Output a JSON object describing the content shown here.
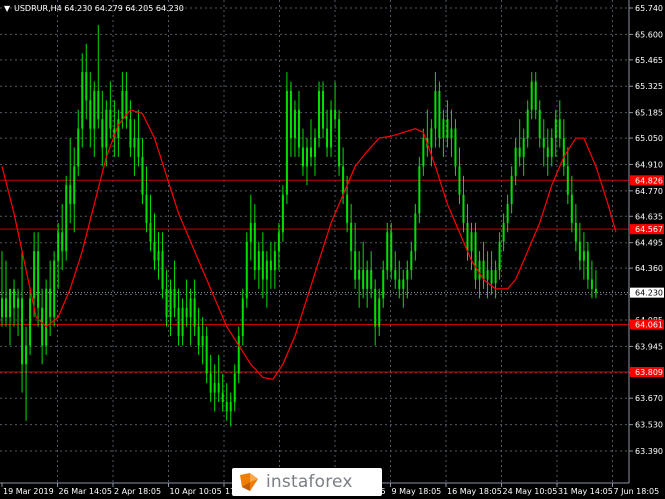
{
  "header": {
    "arrow": "▼",
    "text": "USDRUR,H4  64.230 64.279 64.205 64.230"
  },
  "colors": {
    "background": "#000000",
    "grid": "#4f5a66",
    "candle": "#00e000",
    "ma": "#ff0000",
    "level": "#c80000",
    "label_bg": "#ff0000",
    "current_bg": "#000000"
  },
  "watermark": {
    "text": "instaforex",
    "logo": "instaforex-logo-icon"
  },
  "chart_data": {
    "type": "candlestick",
    "symbol": "USDRUR",
    "timeframe": "H4",
    "ohlc_header": [
      64.23,
      64.279,
      64.205,
      64.23
    ],
    "y_range": [
      63.39,
      65.74
    ],
    "y_ticks": [
      "65.740",
      "65.600",
      "65.465",
      "65.325",
      "65.185",
      "65.050",
      "64.910",
      "64.770",
      "64.635",
      "64.495",
      "64.360",
      "64.220",
      "64.085",
      "63.945",
      "63.805",
      "63.670",
      "63.530",
      "63.390"
    ],
    "x_ticks": [
      "19 Mar 2019",
      "26 Mar 14:05",
      "2 Apr 18:05",
      "10 Apr 10:05",
      "17 Apr 18:05",
      "24 Apr 18:05",
      "2 May 10:05",
      "9 May 18:05",
      "16 May 18:05",
      "24 May 10:05",
      "31 May 14:05",
      "7 Jun 18:05"
    ],
    "levels": [
      {
        "value": 64.826,
        "label": "64.826"
      },
      {
        "value": 64.567,
        "label": "64.567"
      },
      {
        "value": 64.061,
        "label": "64.061"
      },
      {
        "value": 63.809,
        "label": "63.809"
      }
    ],
    "current_price": {
      "value": 64.23,
      "label": "64.230"
    },
    "grid": true,
    "moving_average": [
      [
        0,
        64.9
      ],
      [
        6,
        64.65
      ],
      [
        12,
        64.35
      ],
      [
        17,
        64.1
      ],
      [
        22,
        64.05
      ],
      [
        28,
        64.1
      ],
      [
        34,
        64.25
      ],
      [
        40,
        64.45
      ],
      [
        46,
        64.7
      ],
      [
        52,
        64.95
      ],
      [
        58,
        65.12
      ],
      [
        64,
        65.2
      ],
      [
        70,
        65.18
      ],
      [
        76,
        65.05
      ],
      [
        82,
        64.85
      ],
      [
        88,
        64.65
      ],
      [
        94,
        64.5
      ],
      [
        100,
        64.35
      ],
      [
        106,
        64.2
      ],
      [
        112,
        64.05
      ],
      [
        118,
        63.95
      ],
      [
        124,
        63.85
      ],
      [
        130,
        63.78
      ],
      [
        135,
        63.77
      ],
      [
        140,
        63.85
      ],
      [
        146,
        64.0
      ],
      [
        152,
        64.2
      ],
      [
        158,
        64.4
      ],
      [
        164,
        64.6
      ],
      [
        170,
        64.75
      ],
      [
        176,
        64.9
      ],
      [
        182,
        64.98
      ],
      [
        188,
        65.05
      ],
      [
        194,
        65.06
      ],
      [
        200,
        65.08
      ],
      [
        206,
        65.1
      ],
      [
        210,
        65.08
      ],
      [
        216,
        64.9
      ],
      [
        222,
        64.7
      ],
      [
        228,
        64.55
      ],
      [
        234,
        64.4
      ],
      [
        240,
        64.3
      ],
      [
        246,
        64.25
      ],
      [
        252,
        64.25
      ],
      [
        256,
        64.3
      ],
      [
        262,
        64.45
      ],
      [
        268,
        64.6
      ],
      [
        274,
        64.8
      ],
      [
        280,
        64.95
      ],
      [
        286,
        65.05
      ],
      [
        290,
        65.05
      ],
      [
        296,
        64.9
      ],
      [
        302,
        64.7
      ],
      [
        306,
        64.55
      ]
    ],
    "candles": [
      [
        0,
        64.1,
        64.45,
        64.05,
        64.2
      ],
      [
        2,
        64.2,
        64.4,
        64.05,
        64.1
      ],
      [
        4,
        64.1,
        64.25,
        63.95,
        64.25
      ],
      [
        6,
        64.25,
        64.3,
        64.05,
        64.15
      ],
      [
        8,
        64.15,
        64.25,
        64.0,
        64.2
      ],
      [
        10,
        64.2,
        64.45,
        63.7,
        63.85
      ],
      [
        12,
        63.85,
        64.05,
        63.55,
        63.95
      ],
      [
        14,
        63.95,
        64.25,
        63.9,
        64.2
      ],
      [
        16,
        64.2,
        64.55,
        64.1,
        64.45
      ],
      [
        18,
        64.45,
        64.55,
        64.05,
        64.15
      ],
      [
        20,
        64.15,
        64.25,
        63.85,
        63.95
      ],
      [
        22,
        63.95,
        64.3,
        63.9,
        64.25
      ],
      [
        24,
        64.25,
        64.4,
        64.0,
        64.1
      ],
      [
        26,
        64.1,
        64.45,
        64.05,
        64.4
      ],
      [
        28,
        64.4,
        64.6,
        64.25,
        64.55
      ],
      [
        30,
        64.55,
        64.7,
        64.35,
        64.45
      ],
      [
        32,
        64.45,
        64.85,
        64.4,
        64.8
      ],
      [
        34,
        64.8,
        65.05,
        64.6,
        64.7
      ],
      [
        36,
        64.7,
        65.0,
        64.55,
        64.9
      ],
      [
        38,
        64.9,
        65.2,
        64.85,
        65.1
      ],
      [
        40,
        65.1,
        65.5,
        65.0,
        65.4
      ],
      [
        42,
        65.4,
        65.55,
        65.15,
        65.25
      ],
      [
        44,
        65.25,
        65.4,
        65.0,
        65.1
      ],
      [
        46,
        65.1,
        65.35,
        64.95,
        65.3
      ],
      [
        48,
        65.3,
        65.65,
        65.1,
        65.15
      ],
      [
        50,
        65.15,
        65.3,
        64.9,
        65.0
      ],
      [
        52,
        65.0,
        65.25,
        64.9,
        65.2
      ],
      [
        54,
        65.2,
        65.35,
        65.05,
        65.1
      ],
      [
        56,
        65.1,
        65.25,
        64.95,
        65.05
      ],
      [
        58,
        65.05,
        65.2,
        64.95,
        65.15
      ],
      [
        60,
        65.15,
        65.4,
        65.1,
        65.3
      ],
      [
        62,
        65.3,
        65.4,
        65.1,
        65.15
      ],
      [
        64,
        65.15,
        65.25,
        64.95,
        65.0
      ],
      [
        66,
        65.0,
        65.15,
        64.85,
        65.05
      ],
      [
        68,
        65.05,
        65.2,
        64.9,
        64.95
      ],
      [
        70,
        64.95,
        65.05,
        64.7,
        64.75
      ],
      [
        72,
        64.75,
        64.9,
        64.55,
        64.6
      ],
      [
        74,
        64.6,
        64.75,
        64.45,
        64.5
      ],
      [
        76,
        64.5,
        64.65,
        64.35,
        64.4
      ],
      [
        78,
        64.4,
        64.55,
        64.3,
        64.45
      ],
      [
        80,
        64.45,
        64.55,
        64.2,
        64.25
      ],
      [
        82,
        64.25,
        64.35,
        64.05,
        64.1
      ],
      [
        84,
        64.1,
        64.3,
        64.0,
        64.25
      ],
      [
        86,
        64.25,
        64.4,
        64.1,
        64.15
      ],
      [
        88,
        64.15,
        64.25,
        63.95,
        64.0
      ],
      [
        90,
        64.0,
        64.2,
        63.95,
        64.15
      ],
      [
        92,
        64.15,
        64.3,
        64.05,
        64.1
      ],
      [
        94,
        64.1,
        64.25,
        63.95,
        64.2
      ],
      [
        96,
        64.2,
        64.3,
        64.0,
        64.05
      ],
      [
        98,
        64.05,
        64.15,
        63.9,
        63.95
      ],
      [
        100,
        63.95,
        64.1,
        63.85,
        64.0
      ],
      [
        102,
        64.0,
        64.05,
        63.75,
        63.8
      ],
      [
        104,
        63.8,
        63.9,
        63.65,
        63.7
      ],
      [
        106,
        63.7,
        63.85,
        63.6,
        63.75
      ],
      [
        108,
        63.75,
        63.9,
        63.65,
        63.7
      ],
      [
        110,
        63.7,
        63.8,
        63.6,
        63.65
      ],
      [
        112,
        63.65,
        63.75,
        63.55,
        63.6
      ],
      [
        114,
        63.6,
        63.7,
        63.52,
        63.65
      ],
      [
        116,
        63.65,
        63.85,
        63.6,
        63.8
      ],
      [
        118,
        63.8,
        64.05,
        63.75,
        64.0
      ],
      [
        120,
        64.0,
        64.25,
        63.95,
        64.2
      ],
      [
        122,
        64.2,
        64.55,
        64.15,
        64.5
      ],
      [
        124,
        64.5,
        64.75,
        64.4,
        64.6
      ],
      [
        126,
        64.6,
        64.7,
        64.3,
        64.35
      ],
      [
        128,
        64.35,
        64.5,
        64.25,
        64.45
      ],
      [
        130,
        64.45,
        64.55,
        64.2,
        64.3
      ],
      [
        132,
        64.3,
        64.45,
        64.15,
        64.4
      ],
      [
        134,
        64.4,
        64.5,
        64.25,
        64.35
      ],
      [
        136,
        64.35,
        64.5,
        64.25,
        64.45
      ],
      [
        138,
        64.45,
        64.6,
        64.35,
        64.55
      ],
      [
        140,
        64.55,
        64.8,
        64.5,
        64.75
      ],
      [
        142,
        64.75,
        65.4,
        64.7,
        65.3
      ],
      [
        144,
        65.3,
        65.35,
        64.95,
        65.05
      ],
      [
        146,
        65.05,
        65.25,
        64.95,
        65.2
      ],
      [
        148,
        65.2,
        65.3,
        64.95,
        65.0
      ],
      [
        150,
        65.0,
        65.1,
        64.85,
        64.9
      ],
      [
        152,
        64.9,
        65.05,
        64.8,
        65.0
      ],
      [
        154,
        65.0,
        65.15,
        64.9,
        64.95
      ],
      [
        156,
        64.95,
        65.1,
        64.85,
        65.05
      ],
      [
        158,
        65.05,
        65.35,
        65.0,
        65.3
      ],
      [
        160,
        65.3,
        65.35,
        65.05,
        65.1
      ],
      [
        162,
        65.1,
        65.2,
        64.95,
        65.0
      ],
      [
        164,
        65.0,
        65.25,
        64.95,
        65.2
      ],
      [
        166,
        65.2,
        65.35,
        65.1,
        65.15
      ],
      [
        168,
        65.15,
        65.2,
        64.85,
        64.9
      ],
      [
        170,
        64.9,
        65.0,
        64.7,
        64.75
      ],
      [
        172,
        64.75,
        64.85,
        64.55,
        64.6
      ],
      [
        174,
        64.6,
        64.7,
        64.35,
        64.45
      ],
      [
        176,
        64.45,
        64.6,
        64.25,
        64.3
      ],
      [
        178,
        64.3,
        64.45,
        64.15,
        64.35
      ],
      [
        180,
        64.35,
        64.5,
        64.2,
        64.25
      ],
      [
        182,
        64.25,
        64.4,
        64.15,
        64.35
      ],
      [
        184,
        64.35,
        64.45,
        64.2,
        64.25
      ],
      [
        186,
        64.25,
        64.3,
        63.95,
        64.05
      ],
      [
        188,
        64.05,
        64.25,
        64.0,
        64.2
      ],
      [
        190,
        64.2,
        64.4,
        64.15,
        64.35
      ],
      [
        192,
        64.35,
        64.6,
        64.3,
        64.55
      ],
      [
        194,
        64.55,
        64.6,
        64.3,
        64.35
      ],
      [
        196,
        64.35,
        64.45,
        64.25,
        64.3
      ],
      [
        198,
        64.3,
        64.4,
        64.2,
        64.25
      ],
      [
        200,
        64.25,
        64.35,
        64.15,
        64.3
      ],
      [
        202,
        64.3,
        64.4,
        64.2,
        64.35
      ],
      [
        204,
        64.35,
        64.5,
        64.3,
        64.45
      ],
      [
        206,
        64.45,
        64.7,
        64.4,
        64.65
      ],
      [
        208,
        64.65,
        64.95,
        64.6,
        64.9
      ],
      [
        210,
        64.9,
        65.1,
        64.85,
        65.05
      ],
      [
        212,
        65.05,
        65.2,
        64.95,
        65.0
      ],
      [
        214,
        65.0,
        65.15,
        64.9,
        65.1
      ],
      [
        216,
        65.1,
        65.4,
        65.0,
        65.3
      ],
      [
        218,
        65.3,
        65.35,
        65.0,
        65.05
      ],
      [
        220,
        65.05,
        65.2,
        64.95,
        65.15
      ],
      [
        222,
        65.15,
        65.25,
        65.0,
        65.05
      ],
      [
        224,
        65.05,
        65.2,
        64.95,
        65.1
      ],
      [
        226,
        65.1,
        65.15,
        64.85,
        64.9
      ],
      [
        228,
        64.9,
        65.0,
        64.7,
        64.75
      ],
      [
        230,
        64.75,
        64.85,
        64.55,
        64.6
      ],
      [
        232,
        64.6,
        64.7,
        64.4,
        64.45
      ],
      [
        234,
        64.45,
        64.6,
        64.35,
        64.55
      ],
      [
        236,
        64.55,
        64.6,
        64.25,
        64.3
      ],
      [
        238,
        64.3,
        64.45,
        64.2,
        64.4
      ],
      [
        240,
        64.4,
        64.5,
        64.25,
        64.3
      ],
      [
        242,
        64.3,
        64.45,
        64.2,
        64.35
      ],
      [
        244,
        64.35,
        64.45,
        64.22,
        64.28
      ],
      [
        246,
        64.28,
        64.4,
        64.2,
        64.35
      ],
      [
        248,
        64.35,
        64.55,
        64.3,
        64.5
      ],
      [
        250,
        64.5,
        64.65,
        64.45,
        64.6
      ],
      [
        252,
        64.6,
        64.75,
        64.55,
        64.7
      ],
      [
        254,
        64.7,
        64.9,
        64.65,
        64.85
      ],
      [
        256,
        64.85,
        65.05,
        64.8,
        65.0
      ],
      [
        258,
        65.0,
        65.15,
        64.9,
        64.95
      ],
      [
        260,
        64.95,
        65.1,
        64.85,
        65.05
      ],
      [
        262,
        65.05,
        65.25,
        65.0,
        65.2
      ],
      [
        264,
        65.2,
        65.4,
        65.15,
        65.35
      ],
      [
        266,
        65.35,
        65.4,
        65.15,
        65.2
      ],
      [
        268,
        65.2,
        65.25,
        65.0,
        65.05
      ],
      [
        270,
        65.05,
        65.15,
        64.9,
        65.0
      ],
      [
        272,
        65.0,
        65.1,
        64.85,
        64.95
      ],
      [
        274,
        64.95,
        65.1,
        64.9,
        65.05
      ],
      [
        276,
        65.05,
        65.2,
        64.95,
        65.15
      ],
      [
        278,
        65.15,
        65.25,
        65.0,
        65.05
      ],
      [
        280,
        65.05,
        65.15,
        64.85,
        64.9
      ],
      [
        282,
        64.9,
        65.0,
        64.7,
        64.75
      ],
      [
        284,
        64.75,
        64.85,
        64.55,
        64.6
      ],
      [
        286,
        64.6,
        64.7,
        64.45,
        64.5
      ],
      [
        288,
        64.5,
        64.6,
        64.35,
        64.4
      ],
      [
        290,
        64.4,
        64.55,
        64.3,
        64.45
      ],
      [
        292,
        64.45,
        64.5,
        64.25,
        64.3
      ],
      [
        294,
        64.3,
        64.4,
        64.2,
        64.25
      ],
      [
        296,
        64.25,
        64.35,
        64.2,
        64.23
      ]
    ]
  }
}
